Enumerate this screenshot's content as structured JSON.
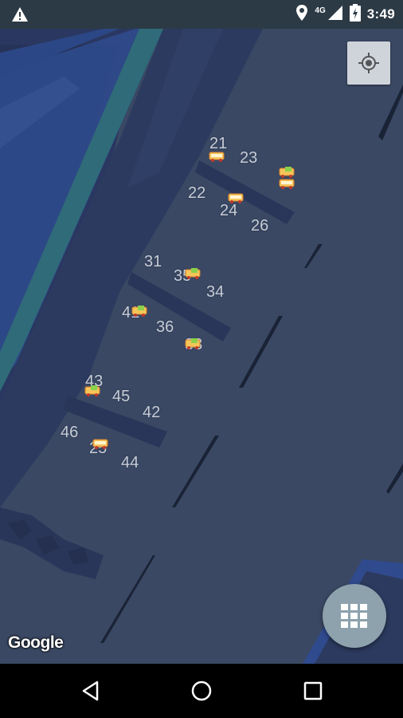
{
  "status_bar": {
    "time": "3:49",
    "network": "4G",
    "icons": [
      "warning-icon",
      "location-pin-icon",
      "signal-icon",
      "battery-charging-icon"
    ]
  },
  "map": {
    "attribution": "Google",
    "gates": [
      "21",
      "23",
      "22",
      "24",
      "26",
      "31",
      "35",
      "34",
      "36",
      "33",
      "41",
      "43",
      "45",
      "42",
      "46",
      "44",
      "25"
    ]
  },
  "controls": {
    "my_location_icon": "crosshair-icon",
    "fab_icon": "grid-icon"
  },
  "nav_bar": {
    "icons": [
      "back-icon",
      "home-icon",
      "recents-icon"
    ]
  },
  "colors": {
    "map_bg": "#3a4863",
    "building": "#2c3a5f",
    "road": "#304e92",
    "teal_band": "#2f6b78",
    "fab": "#8da2ad"
  }
}
